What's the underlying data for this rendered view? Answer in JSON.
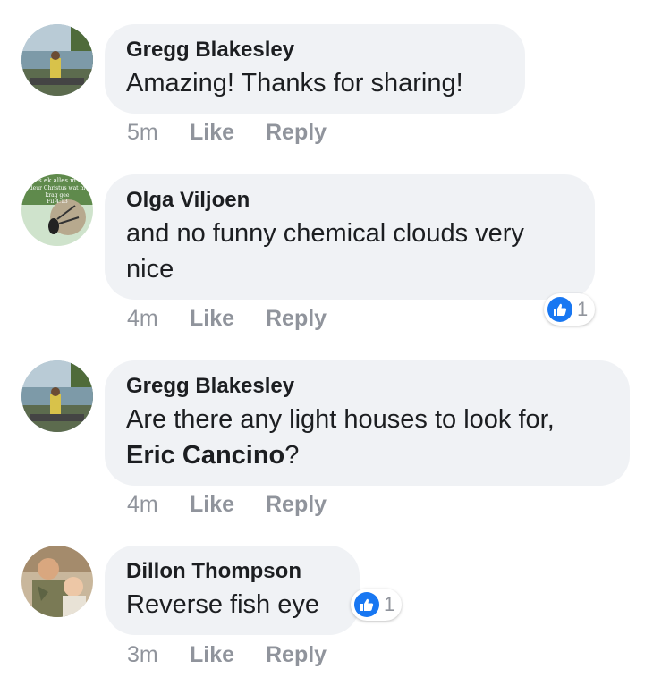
{
  "comments": [
    {
      "author": "Gregg Blakesley",
      "text": "Amazing! Thanks for sharing!",
      "time": "5m",
      "like_label": "Like",
      "reply_label": "Reply"
    },
    {
      "author": "Olga Viljoen",
      "text": "and no funny chemical clouds very nice",
      "time": "4m",
      "like_label": "Like",
      "reply_label": "Reply",
      "avatar_text": [
        "s ek alles m",
        "deur Christus wat m",
        "krag gee",
        "Fil 4:13"
      ],
      "reaction": {
        "icon": "thumbs-up-icon",
        "count": "1"
      }
    },
    {
      "author": "Gregg Blakesley",
      "text": "Are there any light houses to look for,",
      "mention": "Eric Cancino",
      "text_after_mention": "?",
      "time": "4m",
      "like_label": "Like",
      "reply_label": "Reply"
    },
    {
      "author": "Dillon Thompson",
      "text": "Reverse fish eye",
      "time": "3m",
      "like_label": "Like",
      "reply_label": "Reply",
      "reaction": {
        "icon": "thumbs-up-icon",
        "count": "1"
      }
    }
  ],
  "colors": {
    "bubble": "#f0f2f5",
    "meta_text": "#90949c",
    "like_blue": "#1877f2",
    "text": "#1c1e21"
  }
}
